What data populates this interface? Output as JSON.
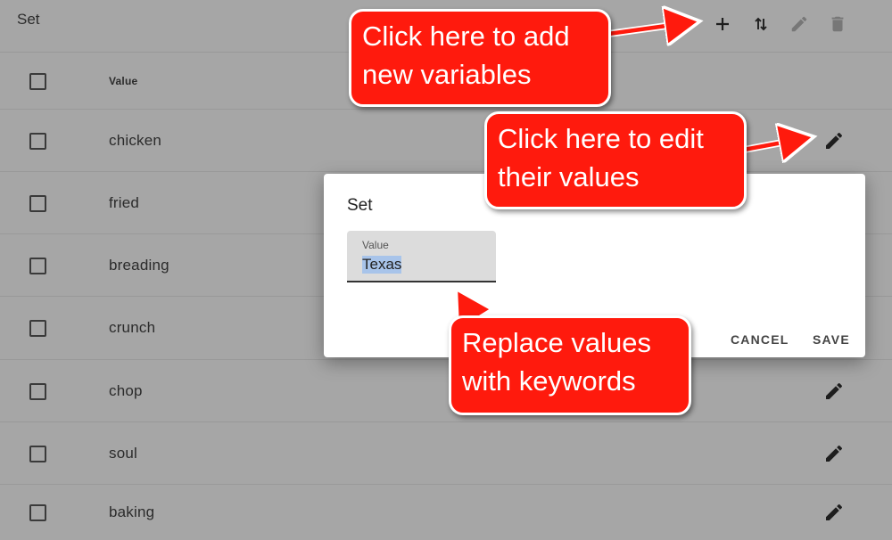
{
  "header": {
    "title": "Set"
  },
  "toolbar": {
    "add_icon": "plus-icon",
    "sort_icon": "swap-vertical-icon",
    "edit_icon": "pencil-icon",
    "delete_icon": "trash-icon"
  },
  "table": {
    "column_header": "Value",
    "rows": [
      {
        "value": "chicken",
        "has_edit": true
      },
      {
        "value": "fried",
        "has_edit": false
      },
      {
        "value": "breading",
        "has_edit": false
      },
      {
        "value": "crunch",
        "has_edit": false
      },
      {
        "value": "chop",
        "has_edit": true
      },
      {
        "value": "soul",
        "has_edit": true
      },
      {
        "value": "baking",
        "has_edit": true
      }
    ]
  },
  "dialog": {
    "title": "Set",
    "field_label": "Value",
    "field_value": "Texas",
    "cancel_label": "CANCEL",
    "save_label": "SAVE"
  },
  "callouts": {
    "add": [
      "Click here to add",
      "new variables"
    ],
    "edit": [
      "Click here to edit",
      "their values"
    ],
    "replace": [
      "Replace values",
      "with keywords"
    ]
  },
  "colors": {
    "overlay_background": "#a6a6a6",
    "callout_fill": "#ff1a0d",
    "callout_border": "#ffffff",
    "selection": "#a8c4ea"
  }
}
